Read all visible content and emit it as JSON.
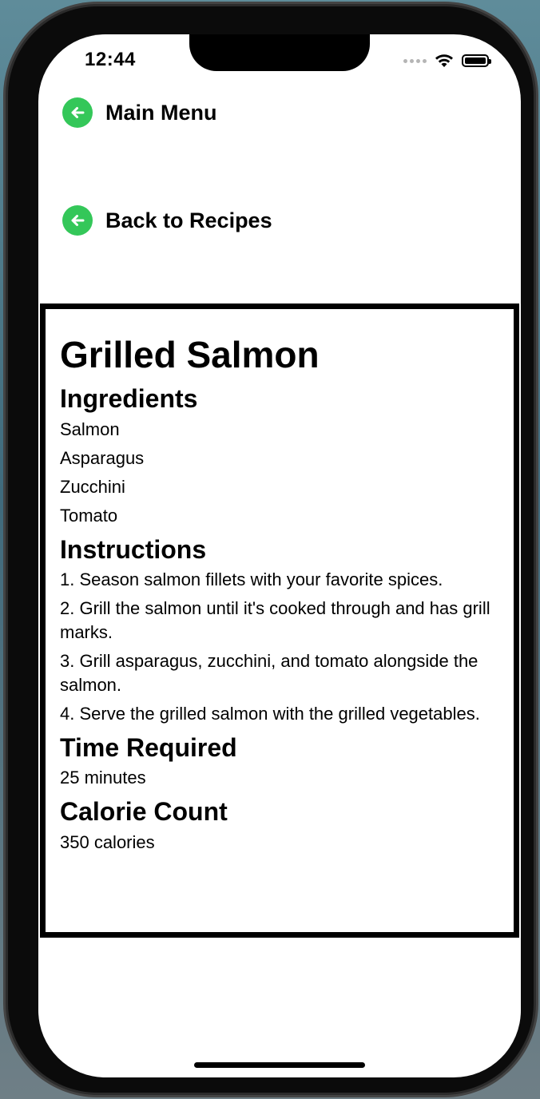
{
  "status_bar": {
    "time": "12:44"
  },
  "navigation": {
    "main_menu_label": "Main Menu",
    "back_label": "Back to Recipes",
    "icon": "arrow-left-circle-icon",
    "accent_color": "#34C759"
  },
  "recipe": {
    "title": "Grilled Salmon",
    "ingredients_heading": "Ingredients",
    "ingredients": [
      "Salmon",
      "Asparagus",
      "Zucchini",
      "Tomato"
    ],
    "instructions_heading": "Instructions",
    "instructions": [
      "1. Season salmon fillets with your favorite spices.",
      "2. Grill the salmon until it's cooked through and has grill marks.",
      "3. Grill asparagus, zucchini, and tomato alongside the salmon.",
      "4. Serve the grilled salmon with the grilled vegetables."
    ],
    "time_heading": "Time Required",
    "time_value": "25 minutes",
    "calorie_heading": "Calorie Count",
    "calorie_value": "350 calories"
  }
}
